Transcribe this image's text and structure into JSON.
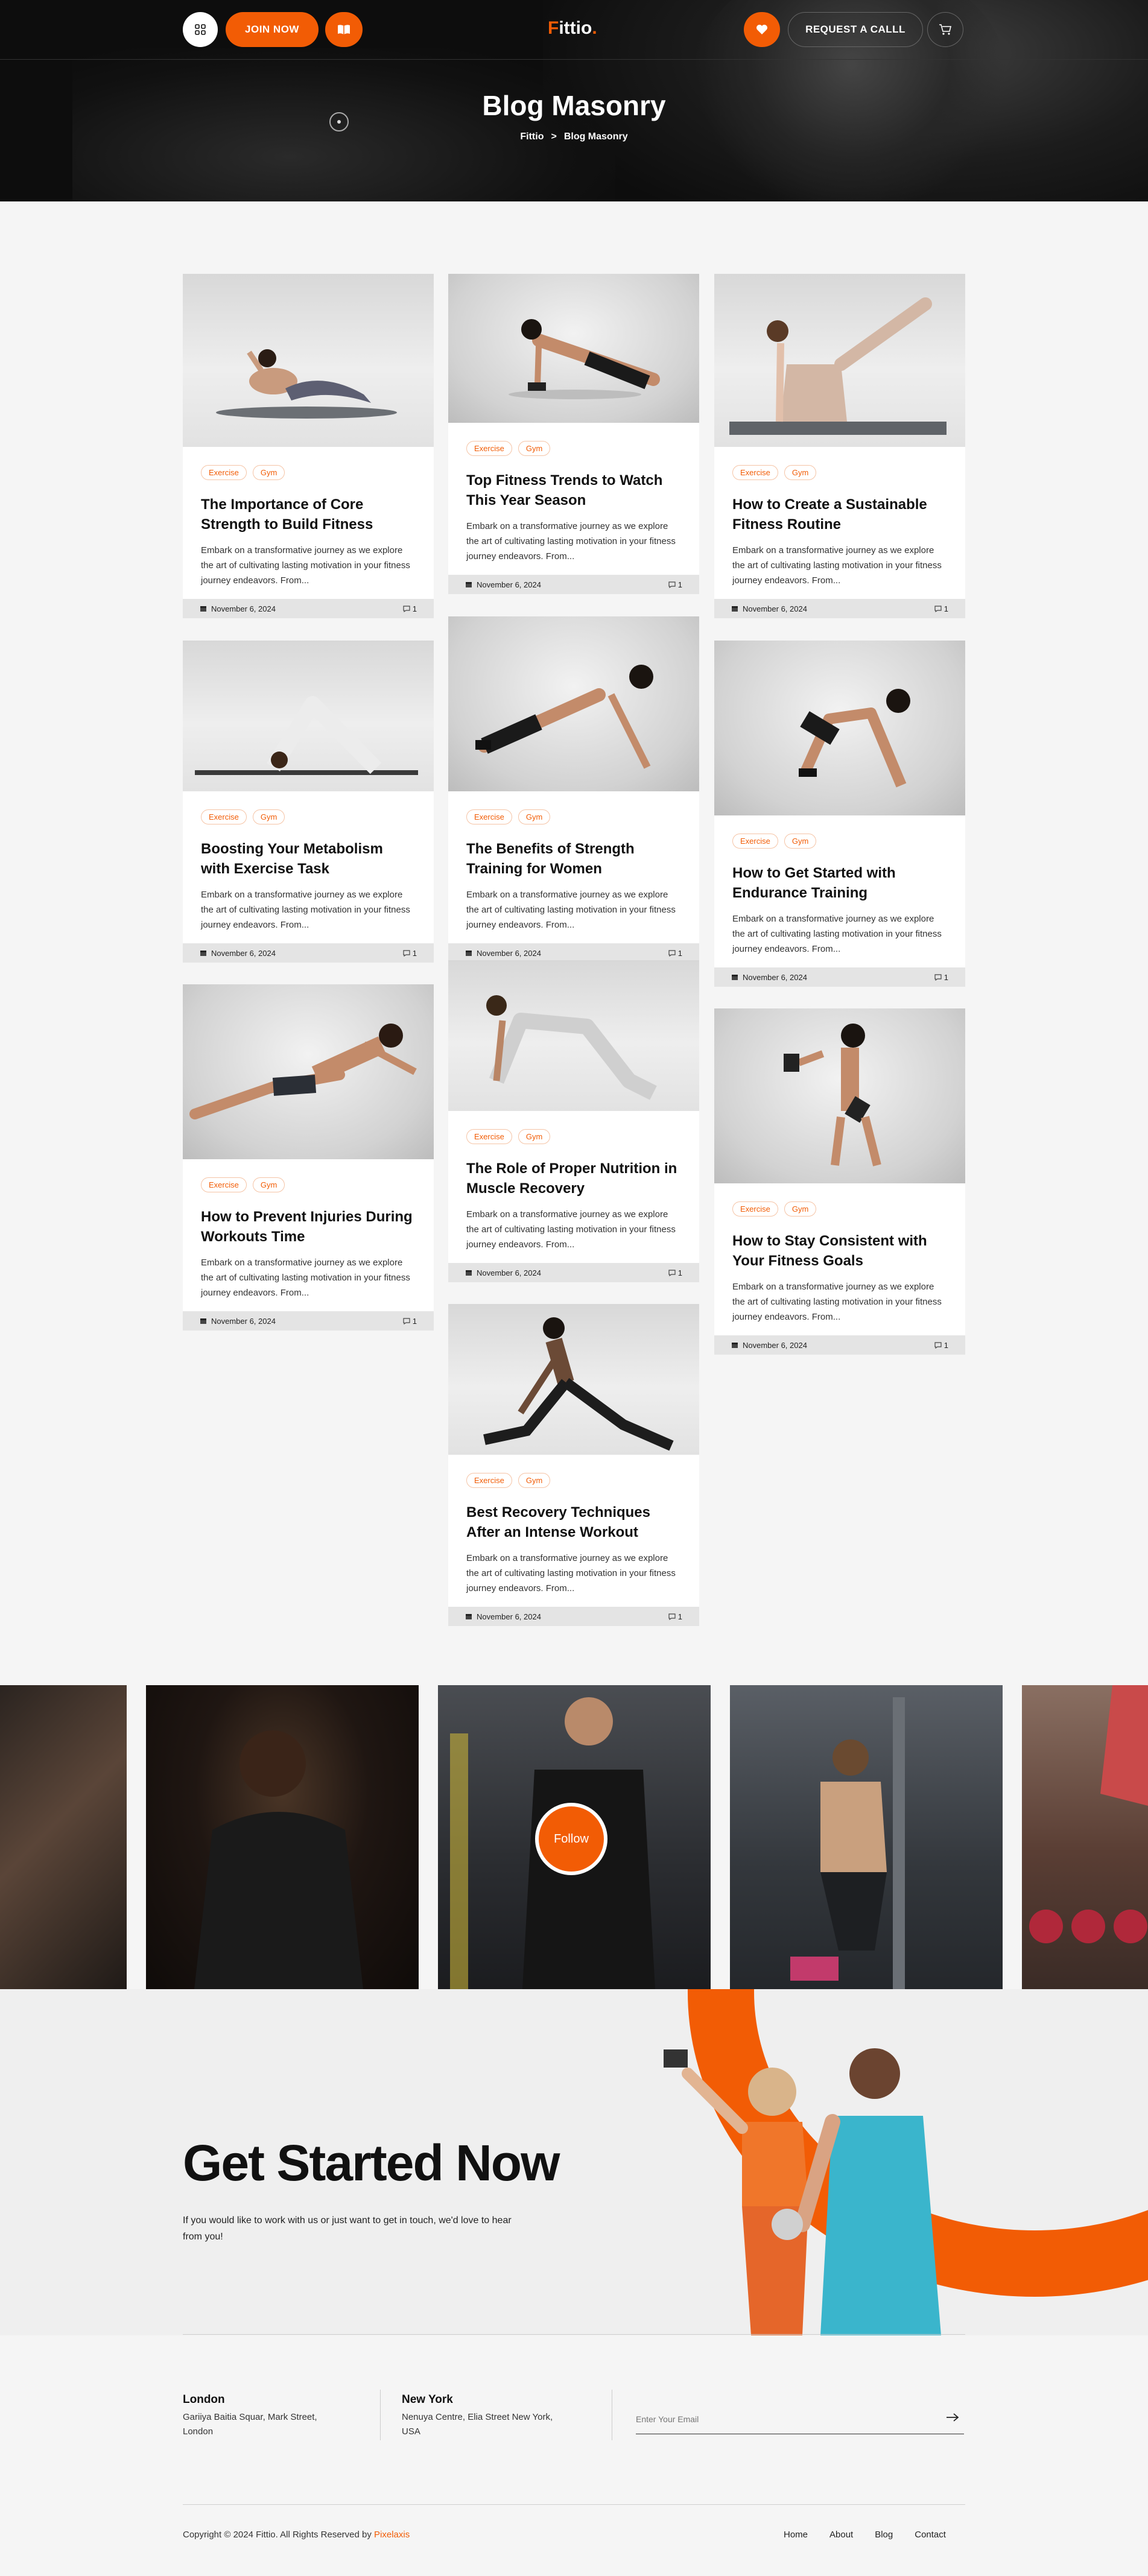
{
  "header": {
    "join_label": "JOIN NOW",
    "logo_first": "F",
    "logo_rest": "ittio",
    "logo_dot": ".",
    "call_label": "REQUEST A CALLL",
    "accent": "#f25c05"
  },
  "hero": {
    "title": "Blog Masonry",
    "breadcrumb_home": "Fittio",
    "breadcrumb_sep": ">",
    "breadcrumb_current": "Blog Masonry"
  },
  "posts": [
    {
      "title": "The Importance of Core Strength to Build Fitness",
      "tags": [
        "Exercise",
        "Gym"
      ],
      "excerpt": "Embark on a transformative journey as we explore the art of cultivating lasting motivation in your fitness journey endeavors. From...",
      "date": "November 6, 2024",
      "comments": "1"
    },
    {
      "title": "Top Fitness Trends to Watch This Year Season",
      "tags": [
        "Exercise",
        "Gym"
      ],
      "excerpt": "Embark on a transformative journey as we explore the art of cultivating lasting motivation in your fitness journey endeavors. From...",
      "date": "November 6, 2024",
      "comments": "1"
    },
    {
      "title": "How to Create a Sustainable Fitness Routine",
      "tags": [
        "Exercise",
        "Gym"
      ],
      "excerpt": "Embark on a transformative journey as we explore the art of cultivating lasting motivation in your fitness journey endeavors. From...",
      "date": "November 6, 2024",
      "comments": "1"
    },
    {
      "title": "Boosting Your Metabolism with Exercise Task",
      "tags": [
        "Exercise",
        "Gym"
      ],
      "excerpt": "Embark on a transformative journey as we explore the art of cultivating lasting motivation in your fitness journey endeavors. From...",
      "date": "November 6, 2024",
      "comments": "1"
    },
    {
      "title": "The Benefits of Strength Training for Women",
      "tags": [
        "Exercise",
        "Gym"
      ],
      "excerpt": "Embark on a transformative journey as we explore the art of cultivating lasting motivation in your fitness journey endeavors. From...",
      "date": "November 6, 2024",
      "comments": "1"
    },
    {
      "title": "How to Get Started with Endurance Training",
      "tags": [
        "Exercise",
        "Gym"
      ],
      "excerpt": "Embark on a transformative journey as we explore the art of cultivating lasting motivation in your fitness journey endeavors. From...",
      "date": "November 6, 2024",
      "comments": "1"
    },
    {
      "title": "How to Prevent Injuries During Workouts Time",
      "tags": [
        "Exercise",
        "Gym"
      ],
      "excerpt": "Embark on a transformative journey as we explore the art of cultivating lasting motivation in your fitness journey endeavors. From...",
      "date": "November 6, 2024",
      "comments": "1"
    },
    {
      "title": "The Role of Proper Nutrition in Muscle Recovery",
      "tags": [
        "Exercise",
        "Gym"
      ],
      "excerpt": "Embark on a transformative journey as we explore the art of cultivating lasting motivation in your fitness journey endeavors. From...",
      "date": "November 6, 2024",
      "comments": "1"
    },
    {
      "title": "How to Stay Consistent with Your Fitness Goals",
      "tags": [
        "Exercise",
        "Gym"
      ],
      "excerpt": "Embark on a transformative journey as we explore the art of cultivating lasting motivation in your fitness journey endeavors. From...",
      "date": "November 6, 2024",
      "comments": "1"
    },
    {
      "title": "Best Recovery Techniques After an Intense Workout",
      "tags": [
        "Exercise",
        "Gym"
      ],
      "excerpt": "Embark on a transformative journey as we explore the art of cultivating lasting motivation in your fitness journey endeavors. From...",
      "date": "November 6, 2024",
      "comments": "1"
    }
  ],
  "gallery": {
    "follow_label": "Follow"
  },
  "cta": {
    "title": "Get Started Now",
    "subtitle": "If you would like to work with us or just want to get in touch, we'd love to hear from you!"
  },
  "footer": {
    "locations": [
      {
        "city": "London",
        "address": "Gariiya Baitia Squar, Mark Street, London"
      },
      {
        "city": "New York",
        "address": "Nenuya Centre, Elia Street New York, USA"
      }
    ],
    "email_placeholder": "Enter Your Email",
    "copyright": "Copyright © 2024 Fittio. All Rights Reserved by ",
    "copyright_brand": "Pixelaxis",
    "nav": [
      "Home",
      "About",
      "Blog",
      "Contact"
    ]
  }
}
